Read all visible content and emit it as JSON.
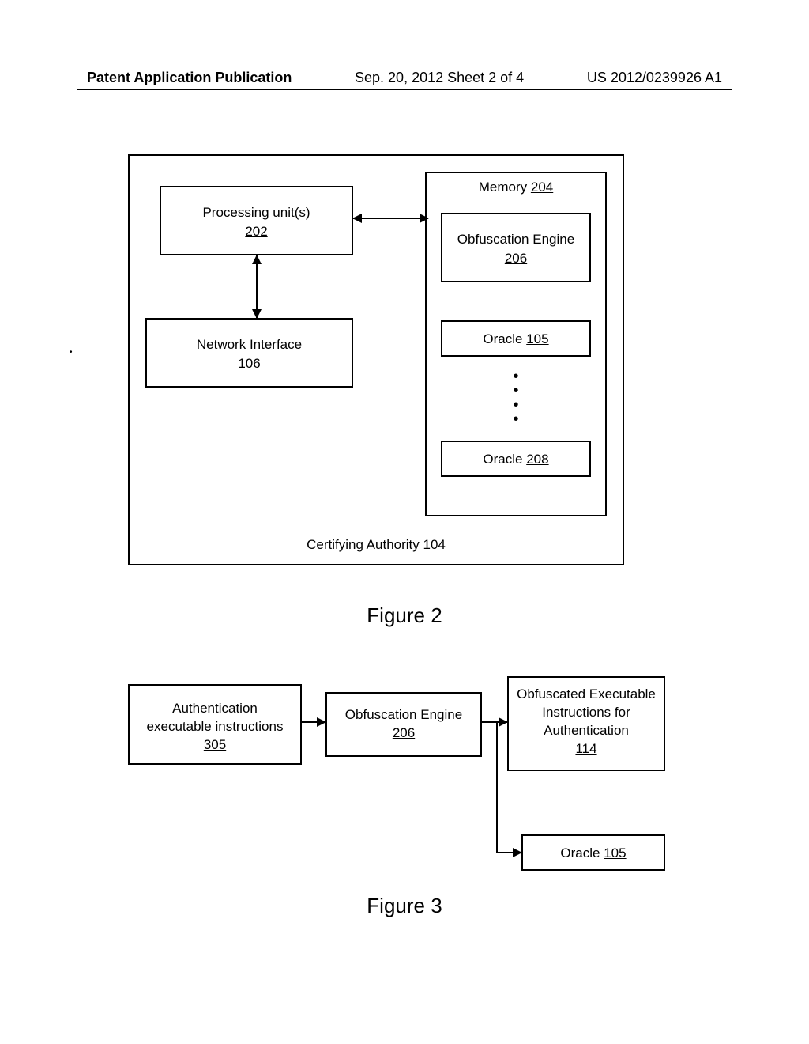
{
  "header": {
    "left": "Patent Application Publication",
    "center": "Sep. 20, 2012  Sheet 2 of 4",
    "right": "US 2012/0239926 A1"
  },
  "fig2": {
    "proc_label": "Processing unit(s)",
    "proc_ref": "202",
    "netif_label": "Network Interface",
    "netif_ref": "106",
    "memory_label": "Memory",
    "memory_ref": "204",
    "obf_label": "Obfuscation Engine",
    "obf_ref": "206",
    "oracle1_label": "Oracle",
    "oracle1_ref": "105",
    "oracle2_label": "Oracle",
    "oracle2_ref": "208",
    "ca_label": "Certifying Authority",
    "ca_ref": "104",
    "title": "Figure 2"
  },
  "fig3": {
    "box1_l1": "Authentication",
    "box1_l2": "executable instructions",
    "box1_ref": "305",
    "box2_label": "Obfuscation Engine",
    "box2_ref": "206",
    "box3_l1": "Obfuscated Executable",
    "box3_l2": "Instructions for",
    "box3_l3": "Authentication",
    "box3_ref": "114",
    "box4_label": "Oracle",
    "box4_ref": "105",
    "title": "Figure 3"
  }
}
